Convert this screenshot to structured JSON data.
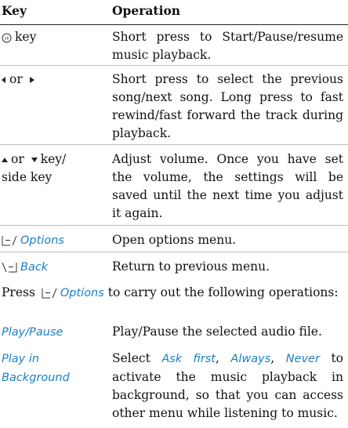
{
  "header": {
    "key": "Key",
    "operation": "Operation"
  },
  "rows": [
    {
      "key_text": "key",
      "operation": "Short press to Start/Pause/resume music playback."
    },
    {
      "key_text": "or",
      "operation": "Short press to select the previous song/next song. Long press to fast rewind/fast forward the track during playback."
    },
    {
      "key_text": "or",
      "key_text2": "key/",
      "key_text3": "side key",
      "operation": "Adjust volume. Once you have set the volume, the settings will be saved until the next time you adjust it again."
    },
    {
      "key_label": "Options",
      "operation": "Open options menu."
    },
    {
      "key_label": "Back",
      "operation": "Return to previous menu."
    }
  ],
  "intro": {
    "prefix": "Press",
    "label": "Options",
    "suffix": "to carry out the following operations:"
  },
  "options": [
    {
      "name": "Play/Pause",
      "desc": "Play/Pause the selected audio file."
    },
    {
      "name": "Play in Background",
      "desc_1": "Select",
      "ask_first": "Ask first",
      "always": "Always",
      "never": "Never",
      "desc_2": "to activate the music playback in background, so that you can access other menu while listening to music."
    }
  ],
  "accent_color": "#1c7fc4"
}
